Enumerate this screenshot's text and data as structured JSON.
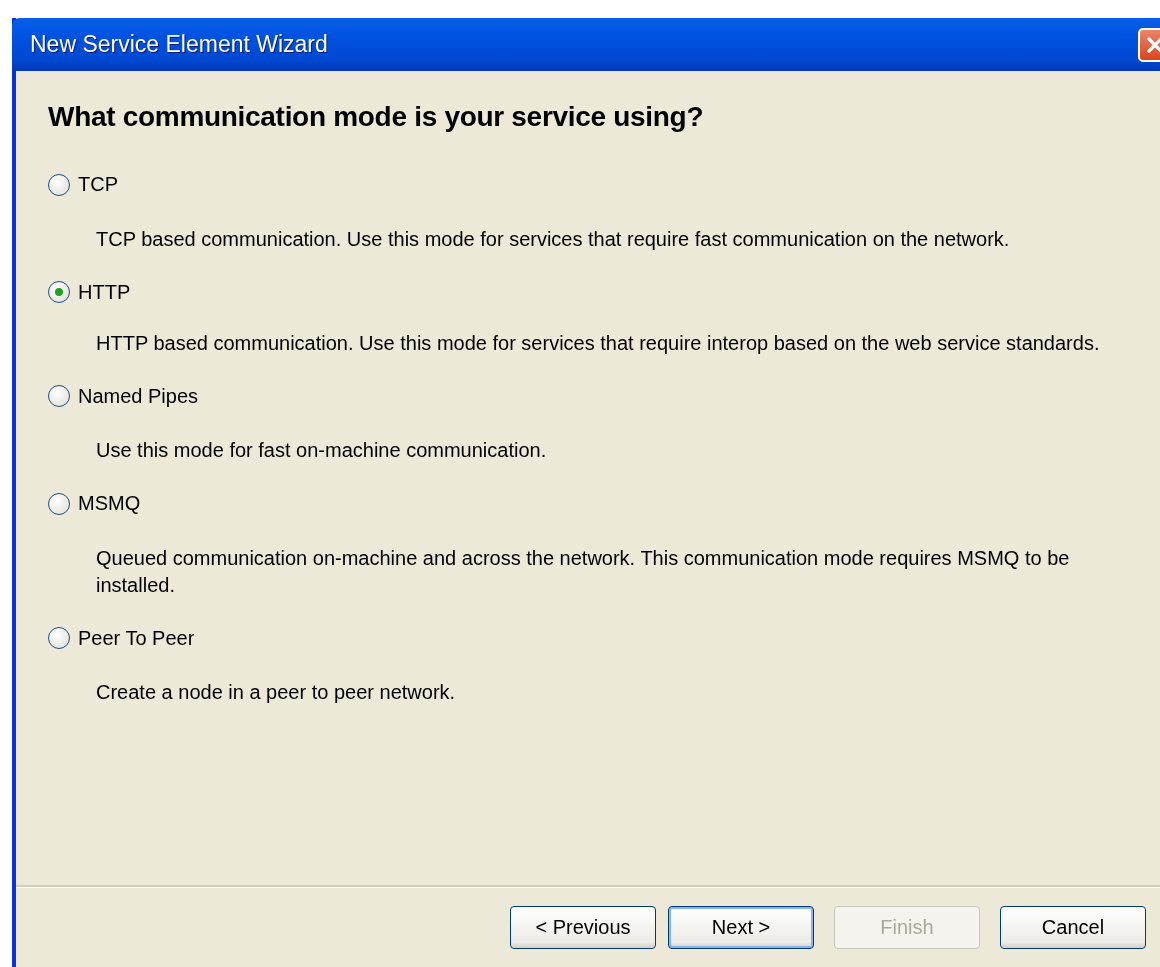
{
  "window": {
    "title": "New Service Element Wizard"
  },
  "heading": "What communication mode is your service using?",
  "options": [
    {
      "label": "TCP",
      "selected": false,
      "description": "TCP based communication. Use this mode for services that require fast communication on the network."
    },
    {
      "label": "HTTP",
      "selected": true,
      "description": "HTTP based communication. Use this mode for services that require interop based on the web service standards."
    },
    {
      "label": "Named Pipes",
      "selected": false,
      "description": "Use this mode for fast on-machine communication."
    },
    {
      "label": "MSMQ",
      "selected": false,
      "description": "Queued communication on-machine and across the network. This communication mode requires MSMQ to be installed."
    },
    {
      "label": "Peer To Peer",
      "selected": false,
      "description": "Create a node in a peer to peer network."
    }
  ],
  "buttons": [
    {
      "label": "< Previous",
      "disabled": false,
      "default": false
    },
    {
      "label": "Next >",
      "disabled": false,
      "default": true
    },
    {
      "label": "Finish",
      "disabled": true,
      "default": false
    },
    {
      "label": "Cancel",
      "disabled": false,
      "default": false
    }
  ]
}
